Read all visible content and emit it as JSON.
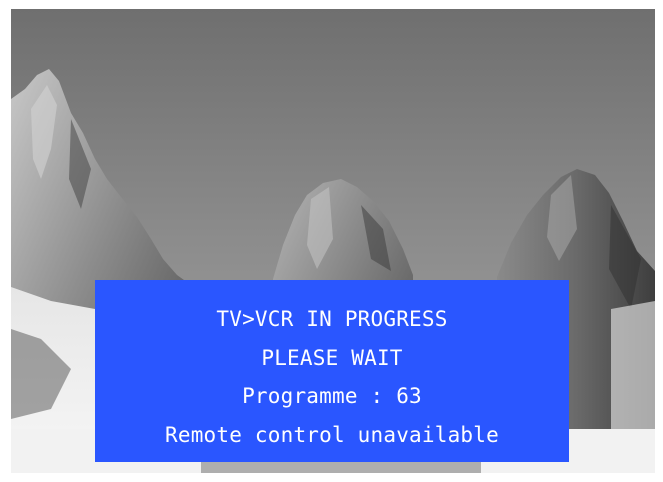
{
  "osd": {
    "lines": [
      "TV>VCR IN PROGRESS",
      "PLEASE WAIT",
      "Programme : 63",
      "Remote control unavailable"
    ]
  },
  "colors": {
    "panel": "#2a56ff",
    "text": "#ffffff",
    "frame": "#ffffff"
  },
  "background": {
    "icon": "mountain-scene-image"
  }
}
